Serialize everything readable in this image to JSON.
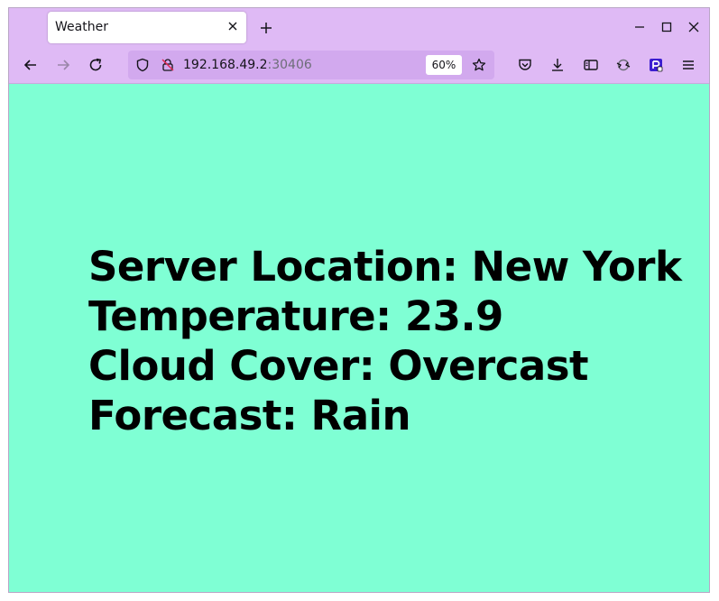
{
  "browser": {
    "tab_title": "Weather",
    "url_host": "192.168.49.2",
    "url_port": ":30406",
    "zoom": "60%",
    "colors": {
      "chrome": "#dfbaf5",
      "urlbar": "#d2a9ee",
      "page_background": "#7fffd4"
    }
  },
  "icons": {
    "tab_close": "close-icon",
    "new_tab": "plus-icon",
    "minimize": "minimize-icon",
    "maximize": "maximize-icon",
    "window_close": "close-icon",
    "back": "arrow-left-icon",
    "forward": "arrow-right-icon",
    "reload": "reload-icon",
    "tracking_protection": "shield-icon",
    "insecure": "lock-slash-icon",
    "bookmark": "star-icon",
    "pocket": "pocket-icon",
    "downloads": "download-icon",
    "reader": "sidebar-icon",
    "sync": "sync-icon",
    "extension": "extension-icon",
    "menu": "hamburger-icon"
  },
  "page": {
    "lines": [
      "Server Location: New York",
      "Temperature: 23.9",
      "Cloud Cover: Overcast",
      "Forecast: Rain"
    ]
  }
}
